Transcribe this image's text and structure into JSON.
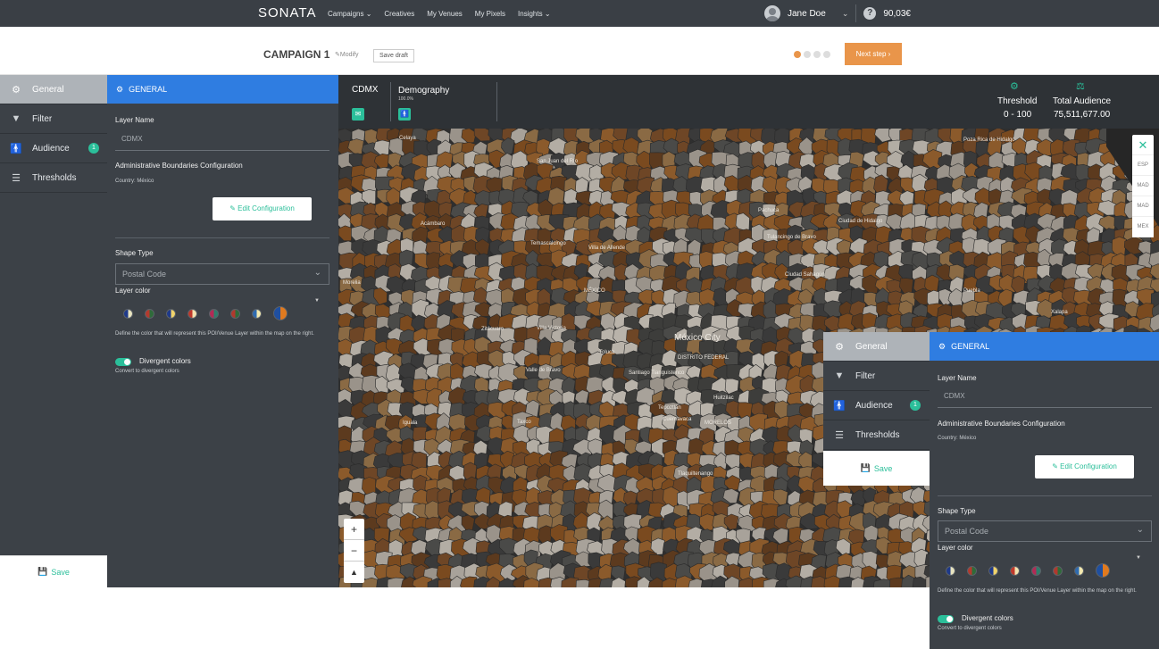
{
  "nav": {
    "logo": "SONATA",
    "links": [
      "Campaigns",
      "Creatives",
      "My Venues",
      "My Pixels",
      "Insights"
    ],
    "user_name": "Jane Doe",
    "balance": "90,03€"
  },
  "campaign": {
    "title": "CAMPAIGN 1",
    "modify_label": "Modify",
    "save_draft_label": "Save draft",
    "step_current": 1,
    "step_total": 4,
    "next_step_label": "Next step"
  },
  "sidebar": {
    "items": [
      {
        "label": "General",
        "icon": "gear-icon",
        "active": true
      },
      {
        "label": "Filter",
        "icon": "filter-icon"
      },
      {
        "label": "Audience",
        "icon": "person-icon",
        "badge": "1"
      },
      {
        "label": "Thresholds",
        "icon": "sliders-icon"
      }
    ],
    "save_label": "Save"
  },
  "general": {
    "header": "GENERAL",
    "layer_name_label": "Layer Name",
    "layer_name_value": "CDMX",
    "admin_boundaries_label": "Administrative Boundaries Configuration",
    "country_text": "Country: México",
    "edit_config_label": "Edit Configuration",
    "shape_type_label": "Shape Type",
    "shape_type_value": "Postal Code",
    "layer_color_label": "Layer color",
    "color_hint": "Define the color that will represent this POI/Venue Layer within the map on the right.",
    "divergent_label": "Divergent colors",
    "divergent_hint": "Convert to divergent colors",
    "swatch_colors": [
      [
        "#1f3a8a",
        "#e8e4c0"
      ],
      [
        "#b43a2e",
        "#2f6b3a"
      ],
      [
        "#1f3a8a",
        "#f0d36b"
      ],
      [
        "#c0392b",
        "#f3e3b0"
      ],
      [
        "#b32a55",
        "#2e7d6b"
      ],
      [
        "#b0392e",
        "#2f6b3a"
      ],
      [
        "#2f6bb0",
        "#f3e9b0"
      ],
      [
        "#1f4fa0",
        "#e07a1f"
      ]
    ]
  },
  "map_header": {
    "layer_name": "CDMX",
    "tab_label": "Demography",
    "tab_sub": "100.0%",
    "threshold_label": "Threshold",
    "threshold_value": "0 - 100",
    "total_audience_label": "Total Audience",
    "total_audience_value": "75,511,677.00"
  },
  "map_labels": [
    "Celaya",
    "San Juan del Río",
    "Pachuca",
    "Poza Rica de Hidalgo",
    "Ciudad de Hidalgo",
    "Acámbaro",
    "Temascalcingo",
    "Villa de Allende",
    "Tulancingo de Bravo",
    "Ciudad Sahagún",
    "Zitácuaro",
    "Morelia",
    "Toluca",
    "MÉXICO",
    "Valle de Bravo",
    "Villa Victoria",
    "México City",
    "DISTRITO FEDERAL",
    "Tepoztlán",
    "Cuernavaca",
    "Santiago Tianguistenco",
    "Iguala",
    "Taxco",
    "Tlaquiltenango",
    "Xalapa",
    "MORELOS",
    "Huitzilac",
    "Puebla"
  ],
  "right_toolbar": [
    "ESP",
    "MAD",
    "MAD",
    "MEX"
  ],
  "colors": {
    "accent_blue": "#2f7de1",
    "accent_orange": "#e9954a",
    "accent_teal": "#2bbf9a",
    "panel_dark": "#3c4147"
  }
}
